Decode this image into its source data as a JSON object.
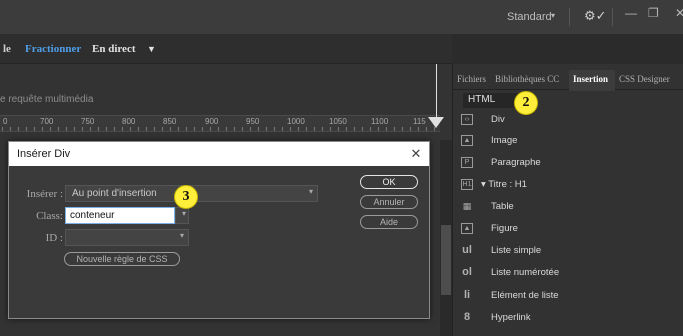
{
  "topbar": {
    "workspace": "Standard",
    "workspace_arrow": "▾",
    "gear_icon": "⚙✓",
    "minimize": "—",
    "restore": "❐",
    "close": "✕"
  },
  "viewbar": {
    "partial": "le",
    "split": "Fractionner",
    "live": "En direct",
    "live_arrow": "▼"
  },
  "document": {
    "media_query": "e requête multimédia",
    "ruler_ticks": [
      "0",
      "700",
      "750",
      "800",
      "850",
      "900",
      "950",
      "1000",
      "1050",
      "1100",
      "115"
    ]
  },
  "dialog": {
    "title": "Insérer Div",
    "insert_label": "Insérer :",
    "insert_value": "Au point d'insertion",
    "class_label": "Class:",
    "class_value": "conteneur",
    "id_label": "ID :",
    "id_value": "",
    "new_css_rule": "Nouvelle règle de CSS",
    "ok": "OK",
    "cancel": "Annuler",
    "help": "Aide"
  },
  "callouts": {
    "dialog_step": "3",
    "panel_step": "2"
  },
  "panel": {
    "tabs": [
      "Fichiers",
      "Bibliothèques CC",
      "Insertion",
      "CSS Designer"
    ],
    "active_tab": "Insertion",
    "category": "HTML",
    "items": [
      {
        "icon": "div-icon",
        "glyph": "‹›",
        "label": "Div"
      },
      {
        "icon": "image-icon",
        "glyph": "▲",
        "label": "Image"
      },
      {
        "icon": "paragraph-icon",
        "glyph": "P",
        "label": "Paragraphe"
      },
      {
        "icon": "heading-icon",
        "glyph": "H1",
        "label": "▾ Titre : H1"
      },
      {
        "icon": "table-icon",
        "glyph": "▦",
        "label": "Table"
      },
      {
        "icon": "figure-icon",
        "glyph": "▲",
        "label": "Figure"
      },
      {
        "icon": "unordered-list-icon",
        "glyph": "ul",
        "label": "Liste simple"
      },
      {
        "icon": "ordered-list-icon",
        "glyph": "ol",
        "label": "Liste numérotée"
      },
      {
        "icon": "list-item-icon",
        "glyph": "li",
        "label": "Elément de liste"
      },
      {
        "icon": "hyperlink-icon",
        "glyph": "8",
        "label": "Hyperlink"
      }
    ]
  },
  "colors": {
    "accent_blue": "#4f9ee8",
    "callout_yellow": "#ffef3a",
    "panel_bg": "#323232"
  }
}
